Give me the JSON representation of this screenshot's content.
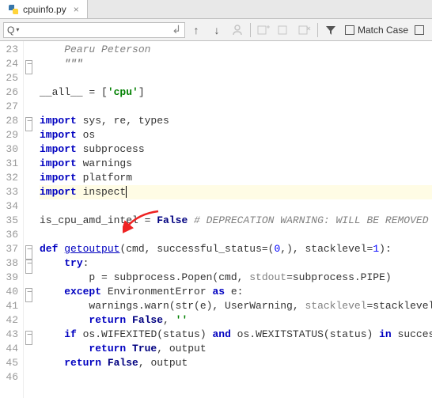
{
  "tab": {
    "filename": "cpuinfo.py"
  },
  "toolbar": {
    "search_placeholder": "",
    "match_case_label": "Match Case"
  },
  "editor": {
    "lines": [
      {
        "n": 23,
        "indent": 1,
        "type": "comment-italic",
        "text": "Pearu Peterson",
        "fold": false
      },
      {
        "n": 24,
        "indent": 1,
        "type": "docstring-close",
        "text": "\"\"\"",
        "fold": true
      },
      {
        "n": 25,
        "indent": 0,
        "type": "blank",
        "text": ""
      },
      {
        "n": 26,
        "indent": 0,
        "type": "all",
        "pre": "__all__ = [",
        "str": "'cpu'",
        "post": "]"
      },
      {
        "n": 27,
        "indent": 0,
        "type": "blank",
        "text": ""
      },
      {
        "n": 28,
        "indent": 0,
        "type": "import",
        "kw": "import",
        "mods": " sys, re, types",
        "fold": true
      },
      {
        "n": 29,
        "indent": 0,
        "type": "import",
        "kw": "import",
        "mods": " os"
      },
      {
        "n": 30,
        "indent": 0,
        "type": "import",
        "kw": "import",
        "mods": " subprocess"
      },
      {
        "n": 31,
        "indent": 0,
        "type": "import",
        "kw": "import",
        "mods": " warnings"
      },
      {
        "n": 32,
        "indent": 0,
        "type": "import",
        "kw": "import",
        "mods": " platform"
      },
      {
        "n": 33,
        "indent": 0,
        "type": "import-hl",
        "kw": "import",
        "mods": " inspect",
        "caret": true
      },
      {
        "n": 34,
        "indent": 0,
        "type": "blank",
        "text": ""
      },
      {
        "n": 35,
        "indent": 0,
        "type": "assign",
        "lhs": "is_cpu_amd_intel = ",
        "bool": "False",
        "comment": " # DEPRECATION WARNING: WILL BE REMOVED IN FUTURE RELEASE"
      },
      {
        "n": 36,
        "indent": 0,
        "type": "blank",
        "text": ""
      },
      {
        "n": 37,
        "indent": 0,
        "type": "def",
        "kw": "def ",
        "name": "getoutput",
        "sig_pre": "(cmd, successful_status=(",
        "num1": "0",
        "sig_mid": ",), stacklevel=",
        "num2": "1",
        "sig_post": "):",
        "fold": true
      },
      {
        "n": 38,
        "indent": 1,
        "type": "try",
        "kw": "try",
        "post": ":",
        "fold": true
      },
      {
        "n": 39,
        "indent": 2,
        "type": "popen",
        "pre": "p = subprocess.Popen(cmd, ",
        "kw2": "stdout",
        "post": "=subprocess.PIPE)"
      },
      {
        "n": 40,
        "indent": 1,
        "type": "except",
        "kw": "except",
        "mid": " EnvironmentError ",
        "kw2": "as",
        "post": " e:",
        "fold": true
      },
      {
        "n": 41,
        "indent": 2,
        "type": "warn",
        "pre": "warnings.warn(str(e), UserWarning, ",
        "kw2": "stacklevel",
        "post": "=stacklevel)"
      },
      {
        "n": 42,
        "indent": 2,
        "type": "return",
        "kw": "return ",
        "bool": "False",
        "post": ", ",
        "str": "''"
      },
      {
        "n": 43,
        "indent": 1,
        "type": "if",
        "kw": "if",
        "mid1": " os.WIFEXITED(status) ",
        "kw2": "and",
        "mid2": " os.WEXITSTATUS(status) ",
        "kw3": "in",
        "post": " successful_status:",
        "fold": true
      },
      {
        "n": 44,
        "indent": 2,
        "type": "return",
        "kw": "return ",
        "bool": "True",
        "post": ", output"
      },
      {
        "n": 45,
        "indent": 1,
        "type": "return",
        "kw": "return ",
        "bool": "False",
        "post": ", output"
      },
      {
        "n": 46,
        "indent": 0,
        "type": "blank",
        "text": ""
      }
    ]
  }
}
